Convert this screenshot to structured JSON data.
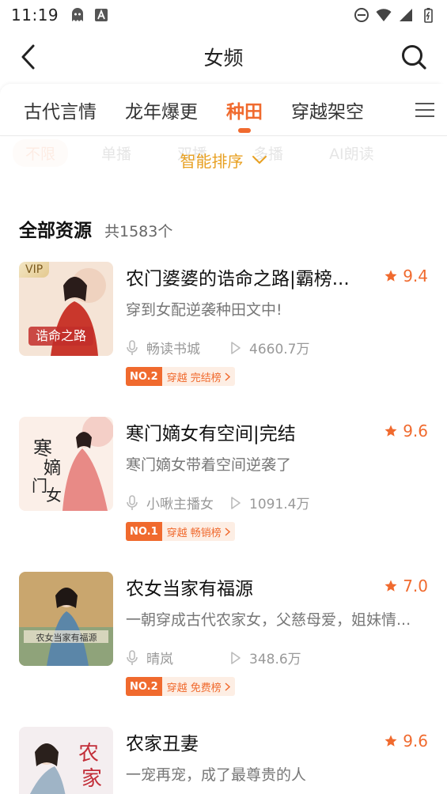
{
  "status_bar": {
    "time": "11:19",
    "icons_left": [
      "ghost-app-icon",
      "font-app-icon"
    ],
    "icons_right": [
      "do-not-disturb-icon",
      "wifi-icon",
      "signal-icon",
      "battery-icon"
    ]
  },
  "header": {
    "title": "女频",
    "back_icon": "back-arrow-icon",
    "search_icon": "search-icon"
  },
  "tabs": [
    {
      "label": "古代言情",
      "active": false
    },
    {
      "label": "龙年爆更",
      "active": false
    },
    {
      "label": "种田",
      "active": true
    },
    {
      "label": "穿越架空",
      "active": false
    }
  ],
  "filters": [
    "不限",
    "单播",
    "双播",
    "多播",
    "AI朗读"
  ],
  "sort": {
    "label": "智能排序"
  },
  "section": {
    "title": "全部资源",
    "count": "共1583个"
  },
  "books": [
    {
      "title": "农门婆婆的诰命之路|霸榜...",
      "rating": "9.4",
      "desc": "穿到女配逆袭种田文中!",
      "narrator": "畅读书城",
      "plays": "4660.7万",
      "rank_no": "NO.2",
      "rank_text": "穿越 完结榜",
      "vip": "VIP",
      "cover_colors": [
        "#f5e4d6",
        "#c9372c"
      ]
    },
    {
      "title": "寒门嫡女有空间|完结",
      "rating": "9.6",
      "desc": "寒门嫡女带着空间逆袭了",
      "narrator": "小啾主播女",
      "plays": "1091.4万",
      "rank_no": "NO.1",
      "rank_text": "穿越 畅销榜",
      "cover_colors": [
        "#fbefe8",
        "#e88a86"
      ]
    },
    {
      "title": "农女当家有福源",
      "rating": "7.0",
      "desc": "一朝穿成古代农家女，父慈母爱，姐妹情...",
      "narrator": "晴岚",
      "plays": "348.6万",
      "rank_no": "NO.2",
      "rank_text": "穿越 免费榜",
      "cover_colors": [
        "#c9a66e",
        "#5b86a8"
      ]
    },
    {
      "title": "农家丑妻",
      "rating": "9.6",
      "desc": "一宠再宠，成了最尊贵的人",
      "cover_colors": [
        "#f4eef0",
        "#c22e39"
      ]
    }
  ],
  "colors": {
    "accent": "#f06a2e",
    "sort": "#e8a021",
    "star": "#f06a2e"
  }
}
